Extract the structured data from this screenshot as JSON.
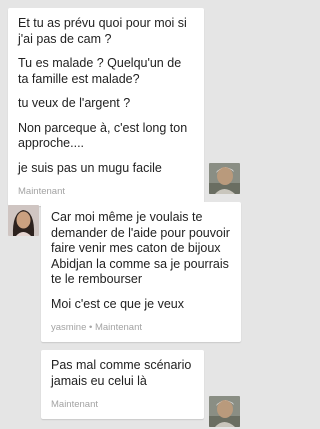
{
  "conversation": {
    "group1": {
      "messages": [
        "Et tu as prévu quoi pour moi si j'ai pas de cam ?",
        "Tu es malade ? Quelqu'un de ta famille est malade?",
        "tu veux de l'argent ?",
        "Non parceque à, c'est long ton approche....",
        "je suis pas un mugu facile"
      ],
      "timestamp": "Maintenant",
      "avatar_icon": "user-avatar-icon"
    },
    "group2": {
      "messages": [
        "Car moi même je voulais te demander de l'aide pour pouvoir faire venir mes caton de bijoux Abidjan la comme sa je pourrais te le rembourser",
        "Moi c'est ce que je veux"
      ],
      "sender": "yasmine",
      "separator": "•",
      "timestamp": "Maintenant",
      "avatar_icon": "contact-avatar-icon"
    },
    "group3": {
      "messages": [
        "Pas mal comme scénario jamais eu celui là"
      ],
      "timestamp": "Maintenant",
      "avatar_icon": "user-avatar-icon"
    }
  },
  "colors": {
    "background": "#e5e5e5",
    "bubble": "#ffffff",
    "text": "#222222",
    "meta": "#a3a3a3"
  }
}
